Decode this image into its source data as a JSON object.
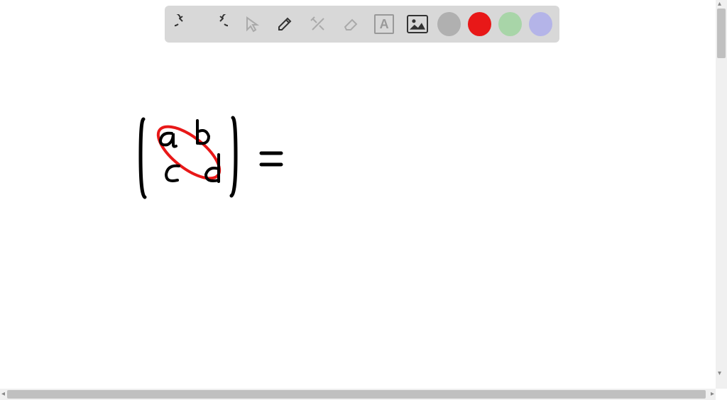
{
  "toolbar": {
    "undo_label": "Undo",
    "redo_label": "Redo",
    "pointer_label": "Select",
    "pen_label": "Pen",
    "tools_label": "Tools",
    "eraser_label": "Eraser",
    "text_label": "Text",
    "text_glyph": "A",
    "image_label": "Image",
    "colors": {
      "gray": "#b0b0b0",
      "red": "#e81818",
      "green": "#a8d5a8",
      "purple": "#b4b4e8"
    }
  },
  "drawing": {
    "matrix": {
      "a": "a",
      "b": "b",
      "c": "c",
      "d": "d"
    },
    "equals": "="
  }
}
